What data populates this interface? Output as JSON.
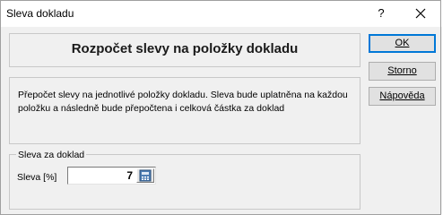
{
  "window": {
    "title": "Sleva dokladu",
    "help_glyph": "?",
    "close_icon": "close-icon"
  },
  "header": {
    "title": "Rozpočet slevy na položky dokladu"
  },
  "description": {
    "text": "Přepočet slevy na jednotlivé položky dokladu. Sleva bude uplatněna na každou položku a následně bude přepočtena i celková částka za doklad"
  },
  "discount_group": {
    "title": "Sleva za doklad",
    "field_label": "Sleva [%]",
    "field_value": "7",
    "calc_icon": "calculator-icon"
  },
  "buttons": {
    "ok": "OK",
    "storno": "Storno",
    "help": "Nápověda"
  }
}
